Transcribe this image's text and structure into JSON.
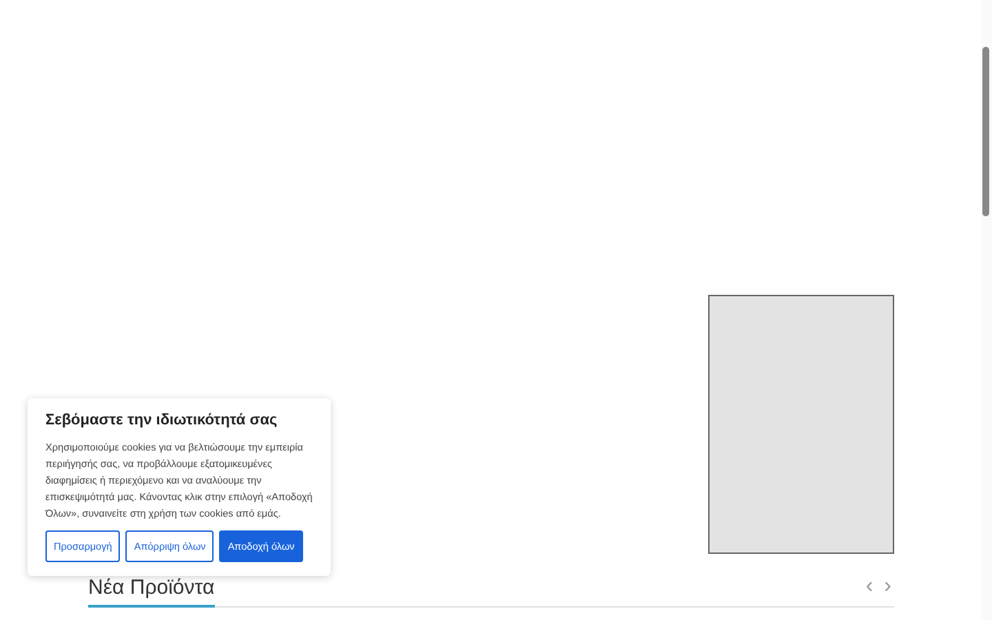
{
  "product_section": {
    "title": "Νέα Προϊόντα",
    "prev": "‹",
    "next": "›"
  },
  "cookie_banner": {
    "title": "Σεβόμαστε την ιδιωτικότητά σας",
    "text": "Χρησιμοποιούμε cookies για να βελτιώσουμε την εμπειρία περιήγησής σας, να προβάλλουμε εξατομικευμένες διαφημίσεις ή περιεχόμενο και να αναλύουμε την επισκεψιμότητά μας. Κάνοντας κλικ στην επιλογή «Αποδοχή Όλων», συναινείτε στη χρήση των cookies από εμάς.",
    "buttons": [
      {
        "label": "Προσαρμογή",
        "kind": "outline"
      },
      {
        "label": "Απόρριψη όλων",
        "kind": "outline"
      },
      {
        "label": "Αποδοχή όλων",
        "kind": "primary"
      }
    ]
  }
}
